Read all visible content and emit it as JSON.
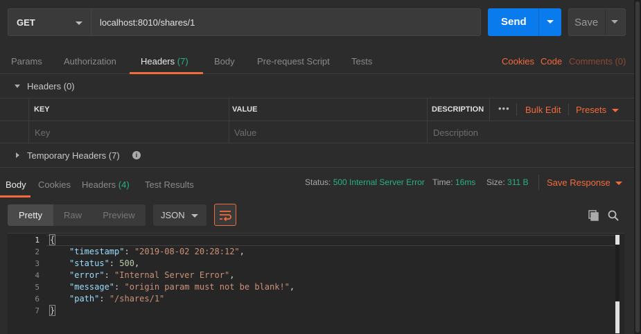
{
  "request": {
    "method": "GET",
    "url": "localhost:8010/shares/1",
    "send_label": "Send",
    "save_label": "Save"
  },
  "request_tabs": [
    {
      "label": "Params",
      "count": ""
    },
    {
      "label": "Authorization",
      "count": ""
    },
    {
      "label": "Headers",
      "count": "(7)"
    },
    {
      "label": "Body",
      "count": ""
    },
    {
      "label": "Pre-request Script",
      "count": ""
    },
    {
      "label": "Tests",
      "count": ""
    }
  ],
  "right_links": {
    "cookies": "Cookies",
    "code": "Code",
    "comments": "Comments (0)"
  },
  "headers_section": {
    "title": "Headers (0)",
    "columns": {
      "key": "KEY",
      "value": "VALUE",
      "description": "DESCRIPTION"
    },
    "placeholders": {
      "key": "Key",
      "value": "Value",
      "description": "Description"
    },
    "dots": "•••",
    "bulk_edit": "Bulk Edit",
    "presets": "Presets"
  },
  "temporary_headers": {
    "title": "Temporary Headers (7)",
    "info": "i"
  },
  "response_tabs": [
    {
      "label": "Body",
      "count": ""
    },
    {
      "label": "Cookies",
      "count": ""
    },
    {
      "label": "Headers",
      "count": "(4)"
    },
    {
      "label": "Test Results",
      "count": ""
    }
  ],
  "response_status": {
    "status_label": "Status:",
    "status_value": "500 Internal Server Error",
    "time_label": "Time:",
    "time_value": "16ms",
    "size_label": "Size:",
    "size_value": "311 B",
    "save_response": "Save Response"
  },
  "view_modes": [
    "Pretty",
    "Raw",
    "Preview"
  ],
  "format": "JSON",
  "code": {
    "line_numbers": [
      "1",
      "2",
      "3",
      "4",
      "5",
      "6",
      "7"
    ],
    "open_brace": "{",
    "close_brace": "}",
    "fields": [
      {
        "key": "\"timestamp\"",
        "sep": ": ",
        "value": "\"2019-08-02 20:28:12\"",
        "type": "s",
        "trail": ","
      },
      {
        "key": "\"status\"",
        "sep": ": ",
        "value": "500",
        "type": "n",
        "trail": ","
      },
      {
        "key": "\"error\"",
        "sep": ": ",
        "value": "\"Internal Server Error\"",
        "type": "s",
        "trail": ","
      },
      {
        "key": "\"message\"",
        "sep": ": ",
        "value": "\"origin param must not be blank!\"",
        "type": "s",
        "trail": ","
      },
      {
        "key": "\"path\"",
        "sep": ": ",
        "value": "\"/shares/1\"",
        "type": "s",
        "trail": ""
      }
    ]
  },
  "colors": {
    "accent": "#f26b3a",
    "send": "#097bed",
    "success": "#26b47f"
  }
}
